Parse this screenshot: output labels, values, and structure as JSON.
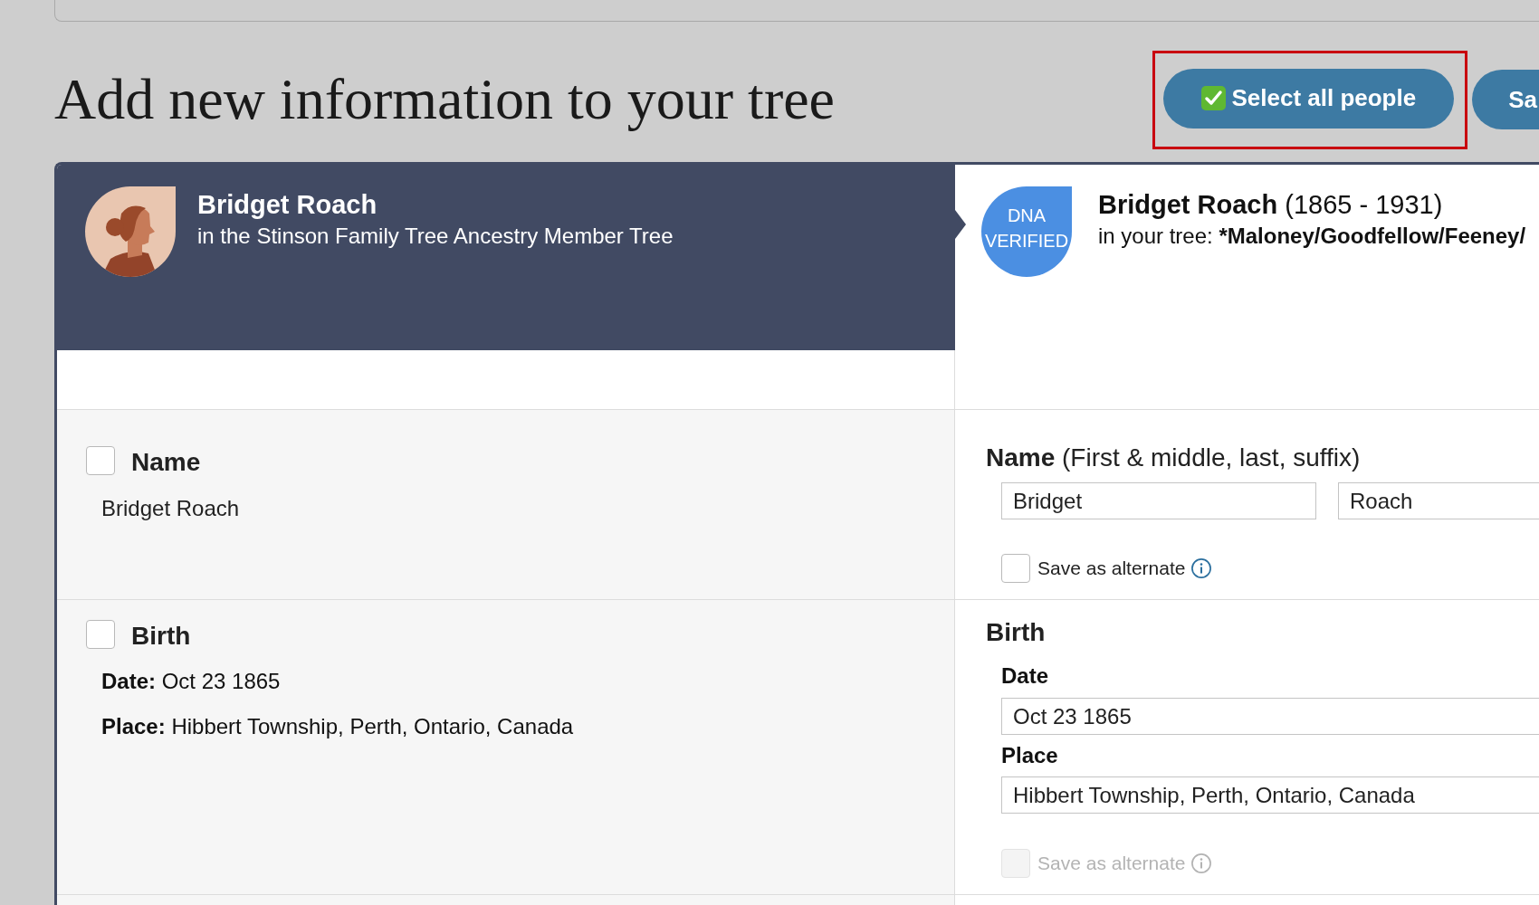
{
  "header": {
    "title": "Add new information to your tree",
    "buttons": [
      {
        "label": "Select all people",
        "kind": "icon",
        "highlighted": true
      },
      {
        "label": "Sa",
        "kind": "text",
        "highlighted": false
      }
    ]
  },
  "source_person": {
    "name": "Bridget Roach",
    "tree": "in the Stinson Family Tree Ancestry Member Tree"
  },
  "tree_person": {
    "badge": [
      "DNA",
      "VERIFIED"
    ],
    "name": "Bridget Roach",
    "years": "(1865 - 1931)",
    "tree_label": "in your tree:",
    "tree_name": "*Maloney/Goodfellow/Feeney/"
  },
  "facts": [
    {
      "kind": "name",
      "source": {
        "label": "Name",
        "checked": false,
        "value": "Bridget Roach"
      },
      "edit": {
        "heading": "Name",
        "hint": "(First & middle, last, suffix)",
        "inputs": [
          {
            "value": "Bridget"
          },
          {
            "value": "Roach"
          }
        ],
        "alternate": {
          "label": "Save as alternate",
          "checked": false,
          "disabled": false
        }
      }
    },
    {
      "kind": "event",
      "source": {
        "label": "Birth",
        "checked": false,
        "details": [
          {
            "label": "Date:",
            "value": "Oct 23 1865"
          },
          {
            "label": "Place:",
            "value": "Hibbert Township, Perth, Ontario, Canada"
          }
        ]
      },
      "edit": {
        "heading": "Birth",
        "fields": [
          {
            "label": "Date",
            "value": "Oct 23 1865"
          },
          {
            "label": "Place",
            "value": "Hibbert Township, Perth, Ontario, Canada"
          }
        ],
        "alternate": {
          "label": "Save as alternate",
          "checked": false,
          "disabled": true
        }
      }
    }
  ]
}
